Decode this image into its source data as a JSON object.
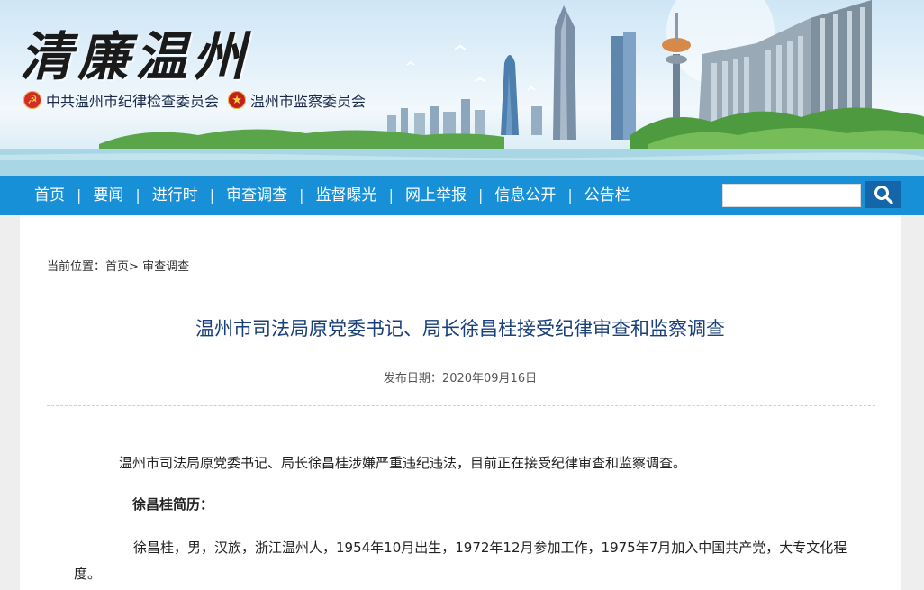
{
  "banner": {
    "logo_text": "清廉温州",
    "orgs": [
      {
        "label": "中共温州市纪律检查委员会",
        "icon": "party-emblem-icon"
      },
      {
        "label": "温州市监察委员会",
        "icon": "national-emblem-icon"
      }
    ]
  },
  "nav": {
    "items": [
      "首页",
      "要闻",
      "进行时",
      "审查调查",
      "监督曝光",
      "网上举报",
      "信息公开",
      "公告栏"
    ],
    "separator": "|"
  },
  "search": {
    "value": "",
    "placeholder": "",
    "button_icon": "search-icon"
  },
  "breadcrumb": {
    "prefix": "当前位置：",
    "home": "首页",
    "sep": ">",
    "current": "审查调查"
  },
  "article": {
    "title": "温州市司法局原党委书记、局长徐昌桂接受纪律审查和监察调查",
    "date_label": "发布日期：",
    "date": "2020年09月16日",
    "para1": "温州市司法局原党委书记、局长徐昌桂涉嫌严重违纪违法，目前正在接受纪律审查和监察调查。",
    "bio_heading": "徐昌桂简历：",
    "para2": "徐昌桂，男，汉族，浙江温州人，1954年10月出生，1972年12月参加工作，1975年7月加入中国共产党，大专文化程度。"
  },
  "colors": {
    "nav_bg": "#1890d8",
    "search_btn": "#1566a8",
    "title": "#1a3f7a",
    "page_bg": "#eeeeee"
  }
}
